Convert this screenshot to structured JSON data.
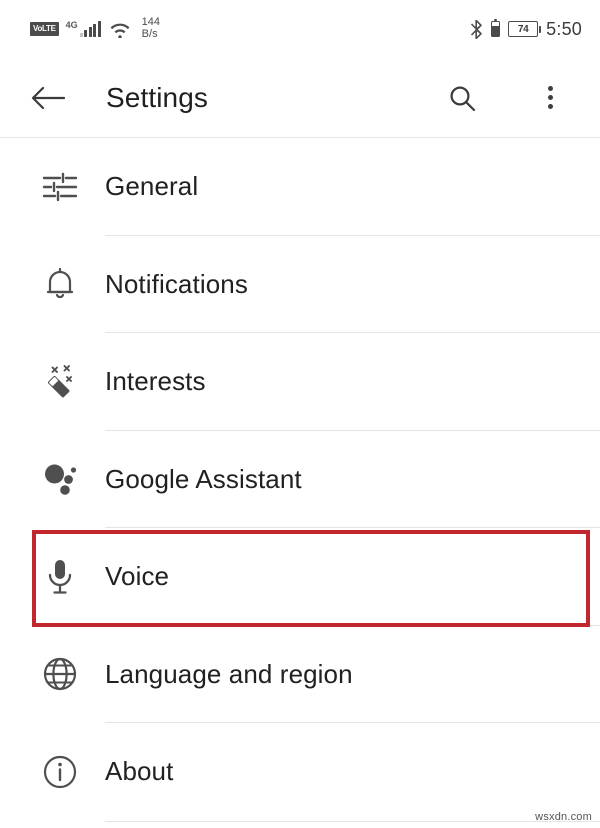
{
  "status_bar": {
    "volte_label": "VoLTE",
    "network_label": "4G",
    "wifi_icon": "wifi-icon",
    "data_speed_value": "144",
    "data_speed_unit": "B/s",
    "bluetooth_icon": "bluetooth-icon",
    "battery_icon": "battery-icon",
    "battery_percent": "74",
    "time": "5:50"
  },
  "toolbar": {
    "back_icon": "back-arrow-icon",
    "title": "Settings",
    "search_icon": "search-icon",
    "more_icon": "overflow-menu-icon"
  },
  "list": {
    "items": [
      {
        "label": "General",
        "icon": "tune-sliders-icon"
      },
      {
        "label": "Notifications",
        "icon": "bell-icon"
      },
      {
        "label": "Interests",
        "icon": "magic-wand-icon"
      },
      {
        "label": "Google Assistant",
        "icon": "google-assistant-icon"
      },
      {
        "label": "Voice",
        "icon": "microphone-icon"
      },
      {
        "label": "Language and region",
        "icon": "globe-icon"
      },
      {
        "label": "About",
        "icon": "info-circle-icon"
      }
    ]
  },
  "highlight": {
    "target_label": "Voice",
    "color": "#c2272d"
  },
  "watermark": {
    "text": "wsxdn.com"
  },
  "colors": {
    "background": "#ffffff",
    "text_primary": "#212121",
    "icon": "#4f4f4f",
    "divider": "#e4e4e4",
    "accent_red": "#c2272d"
  }
}
